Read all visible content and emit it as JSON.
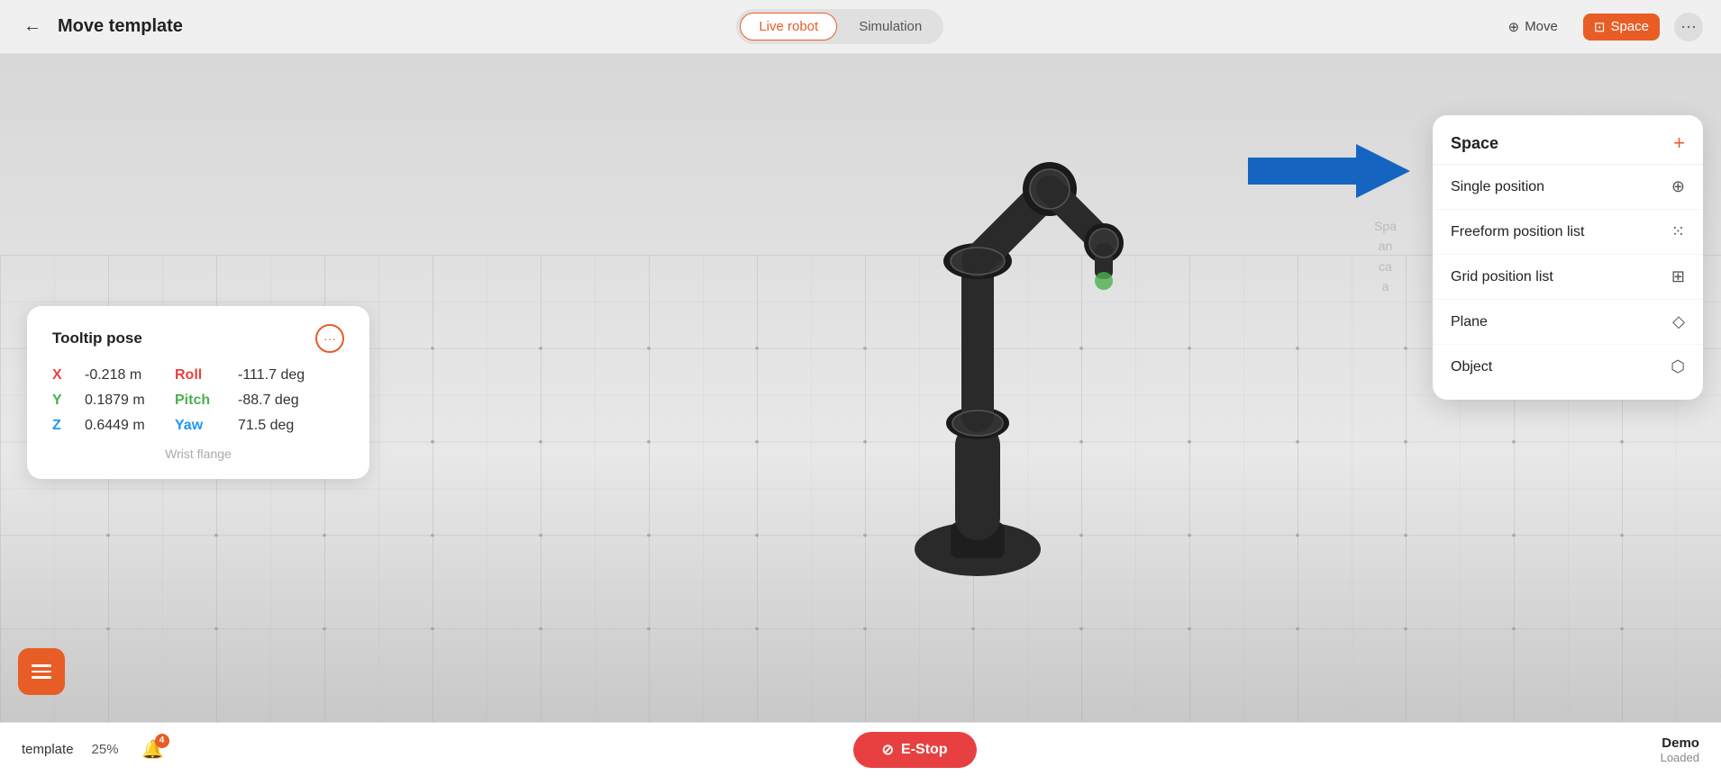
{
  "header": {
    "back_label": "←",
    "title": "Move template",
    "tabs": [
      {
        "id": "live",
        "label": "Live robot",
        "active": true
      },
      {
        "id": "sim",
        "label": "Simulation",
        "active": false
      }
    ],
    "nav_move": "Move",
    "nav_space": "Space",
    "more_icon": "···"
  },
  "tooltip_card": {
    "title": "Tooltip pose",
    "more_icon": "···",
    "rows": [
      {
        "axis": "X",
        "axis_class": "x",
        "value": "-0.218 m",
        "label": "Roll",
        "label_class": "roll",
        "deg": "-111.7  deg"
      },
      {
        "axis": "Y",
        "axis_class": "y",
        "value": "0.1879 m",
        "label": "Pitch",
        "label_class": "pitch",
        "deg": "-88.7  deg"
      },
      {
        "axis": "Z",
        "axis_class": "z",
        "value": "0.6449 m",
        "label": "Yaw",
        "label_class": "yaw",
        "deg": "71.5  deg"
      }
    ],
    "footer": "Wrist flange"
  },
  "space_dropdown": {
    "title": "Space",
    "add_icon": "+",
    "items": [
      {
        "id": "single",
        "label": "Single position",
        "icon": "⊕"
      },
      {
        "id": "freeform",
        "label": "Freeform position list",
        "icon": "⁙"
      },
      {
        "id": "grid",
        "label": "Grid position list",
        "icon": "⊞"
      },
      {
        "id": "plane",
        "label": "Plane",
        "icon": "◇"
      },
      {
        "id": "object",
        "label": "Object",
        "icon": "⬡"
      }
    ]
  },
  "footer": {
    "template_label": "template",
    "progress": "25%",
    "notif_count": "4",
    "estop_label": "E-Stop",
    "demo_label": "Demo",
    "loaded_label": "Loaded"
  },
  "bg_hint": {
    "line1": "Spa",
    "line2": "an",
    "line3": "ca",
    "line4": "a"
  }
}
